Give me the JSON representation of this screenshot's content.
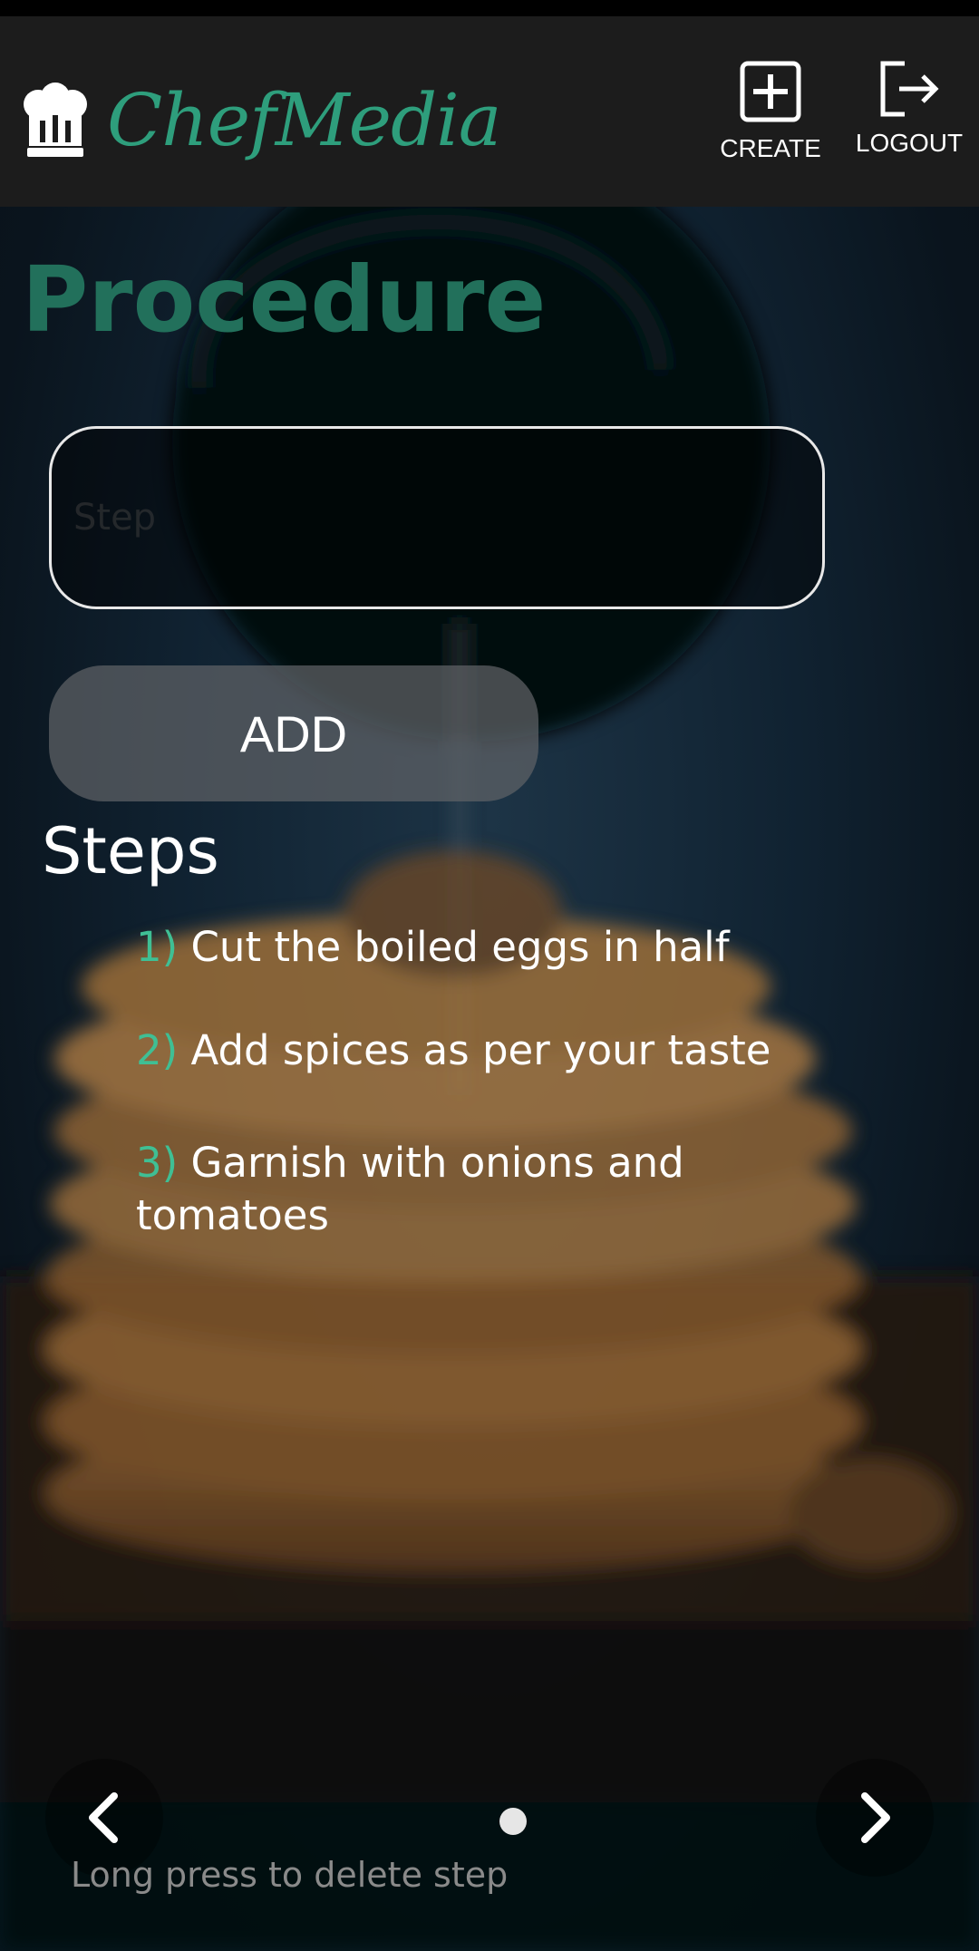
{
  "app": {
    "name": "ChefMedia",
    "actions": {
      "create_label": "CREATE",
      "logout_label": "LOGOUT"
    }
  },
  "page": {
    "title": "Procedure",
    "step_input": {
      "value": "",
      "placeholder": "Step"
    },
    "add_label": "ADD",
    "steps_heading": "Steps",
    "steps": [
      {
        "num": "1)",
        "text": "Cut the boiled eggs in half"
      },
      {
        "num": "2)",
        "text": "Add spices as per your taste"
      },
      {
        "num": "3)",
        "text": "Garnish with onions and tomatoes"
      }
    ],
    "hint": "Long press to delete step"
  },
  "icons": {
    "logo": "chef-hat-icon",
    "create": "plus-square-icon",
    "logout": "logout-arrow-icon",
    "prev": "chevron-left-icon",
    "next": "chevron-right-icon"
  },
  "colors": {
    "brand": "#2e9e7c",
    "title": "#22705b",
    "step_number": "#3fbf94",
    "app_bar": "#1c1c1c"
  }
}
